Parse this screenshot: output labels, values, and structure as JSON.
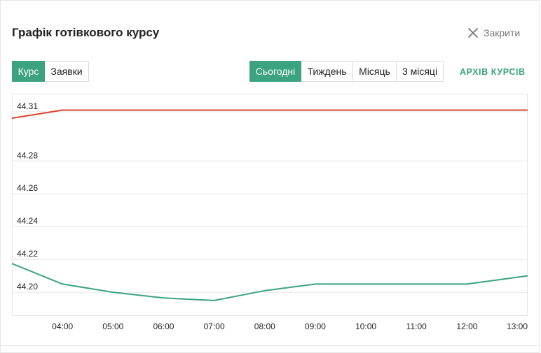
{
  "header": {
    "title": "Графік готівкового курсу",
    "close_label": "Закрити"
  },
  "mode_tabs": [
    {
      "label": "Курс",
      "active": true
    },
    {
      "label": "Заявки",
      "active": false
    }
  ],
  "period_tabs": [
    {
      "label": "Сьогодні",
      "active": true
    },
    {
      "label": "Тиждень",
      "active": false
    },
    {
      "label": "Місяць",
      "active": false
    },
    {
      "label": "3 місяці",
      "active": false
    }
  ],
  "archive_link": "АРХІВ КУРСІВ",
  "colors": {
    "accent": "#3ba37f",
    "sell_line": "#d9452b",
    "buy_line": "#3ba37f",
    "grid": "#e5e5e5"
  },
  "chart_data": {
    "type": "line",
    "x_labels": [
      "04:00",
      "05:00",
      "06:00",
      "07:00",
      "08:00",
      "09:00",
      "10:00",
      "11:00",
      "12:00",
      "13:00"
    ],
    "y_ticks": [
      "44.31",
      "44.28",
      "44.26",
      "44.24",
      "44.22",
      "44.20"
    ],
    "ylim": [
      44.186,
      44.321
    ],
    "grid": true,
    "series": [
      {
        "color": "#d9452b",
        "points": [
          {
            "x": 3.0,
            "y": 44.306
          },
          {
            "x": 4.0,
            "y": 44.311
          },
          {
            "x": 5.0,
            "y": 44.311
          },
          {
            "x": 6.0,
            "y": 44.311
          },
          {
            "x": 7.0,
            "y": 44.311
          },
          {
            "x": 8.0,
            "y": 44.311
          },
          {
            "x": 9.0,
            "y": 44.311
          },
          {
            "x": 10.0,
            "y": 44.311
          },
          {
            "x": 11.0,
            "y": 44.311
          },
          {
            "x": 12.0,
            "y": 44.311
          },
          {
            "x": 13.2,
            "y": 44.311
          }
        ]
      },
      {
        "color": "#3ba37f",
        "points": [
          {
            "x": 3.0,
            "y": 44.2175
          },
          {
            "x": 4.0,
            "y": 44.205
          },
          {
            "x": 5.0,
            "y": 44.2
          },
          {
            "x": 6.0,
            "y": 44.1965
          },
          {
            "x": 7.0,
            "y": 44.195
          },
          {
            "x": 8.0,
            "y": 44.201
          },
          {
            "x": 9.0,
            "y": 44.205
          },
          {
            "x": 10.0,
            "y": 44.205
          },
          {
            "x": 11.0,
            "y": 44.205
          },
          {
            "x": 12.0,
            "y": 44.205
          },
          {
            "x": 13.2,
            "y": 44.21
          }
        ]
      }
    ]
  }
}
